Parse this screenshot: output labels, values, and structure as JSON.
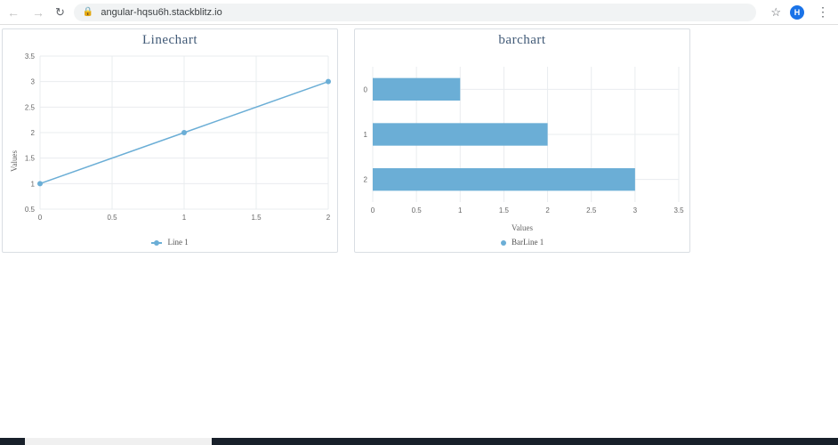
{
  "browser": {
    "url": "angular-hqsu6h.stackblitz.io",
    "avatar_letter": "H"
  },
  "chart_data": [
    {
      "type": "line",
      "title": "Linechart",
      "xlabel": "",
      "ylabel": "Values",
      "x": [
        0,
        1,
        2
      ],
      "series": [
        {
          "name": "Line 1",
          "values": [
            1,
            2,
            3
          ]
        }
      ],
      "xticks": [
        0,
        0.5,
        1,
        1.5,
        2
      ],
      "yticks": [
        0.5,
        1,
        1.5,
        2,
        2.5,
        3,
        3.5
      ],
      "xlim": [
        0,
        2
      ],
      "ylim": [
        0.5,
        3.5
      ],
      "color": "#6baed6"
    },
    {
      "type": "bar",
      "orientation": "horizontal",
      "title": "barchart",
      "xlabel": "Values",
      "ylabel": "",
      "categories": [
        "0",
        "1",
        "2"
      ],
      "series": [
        {
          "name": "BarLine 1",
          "values": [
            1,
            2,
            3
          ]
        }
      ],
      "xticks": [
        0,
        0.5,
        1,
        1.5,
        2,
        2.5,
        3,
        3.5
      ],
      "xlim": [
        0,
        3.5
      ],
      "color": "#6baed6"
    }
  ]
}
